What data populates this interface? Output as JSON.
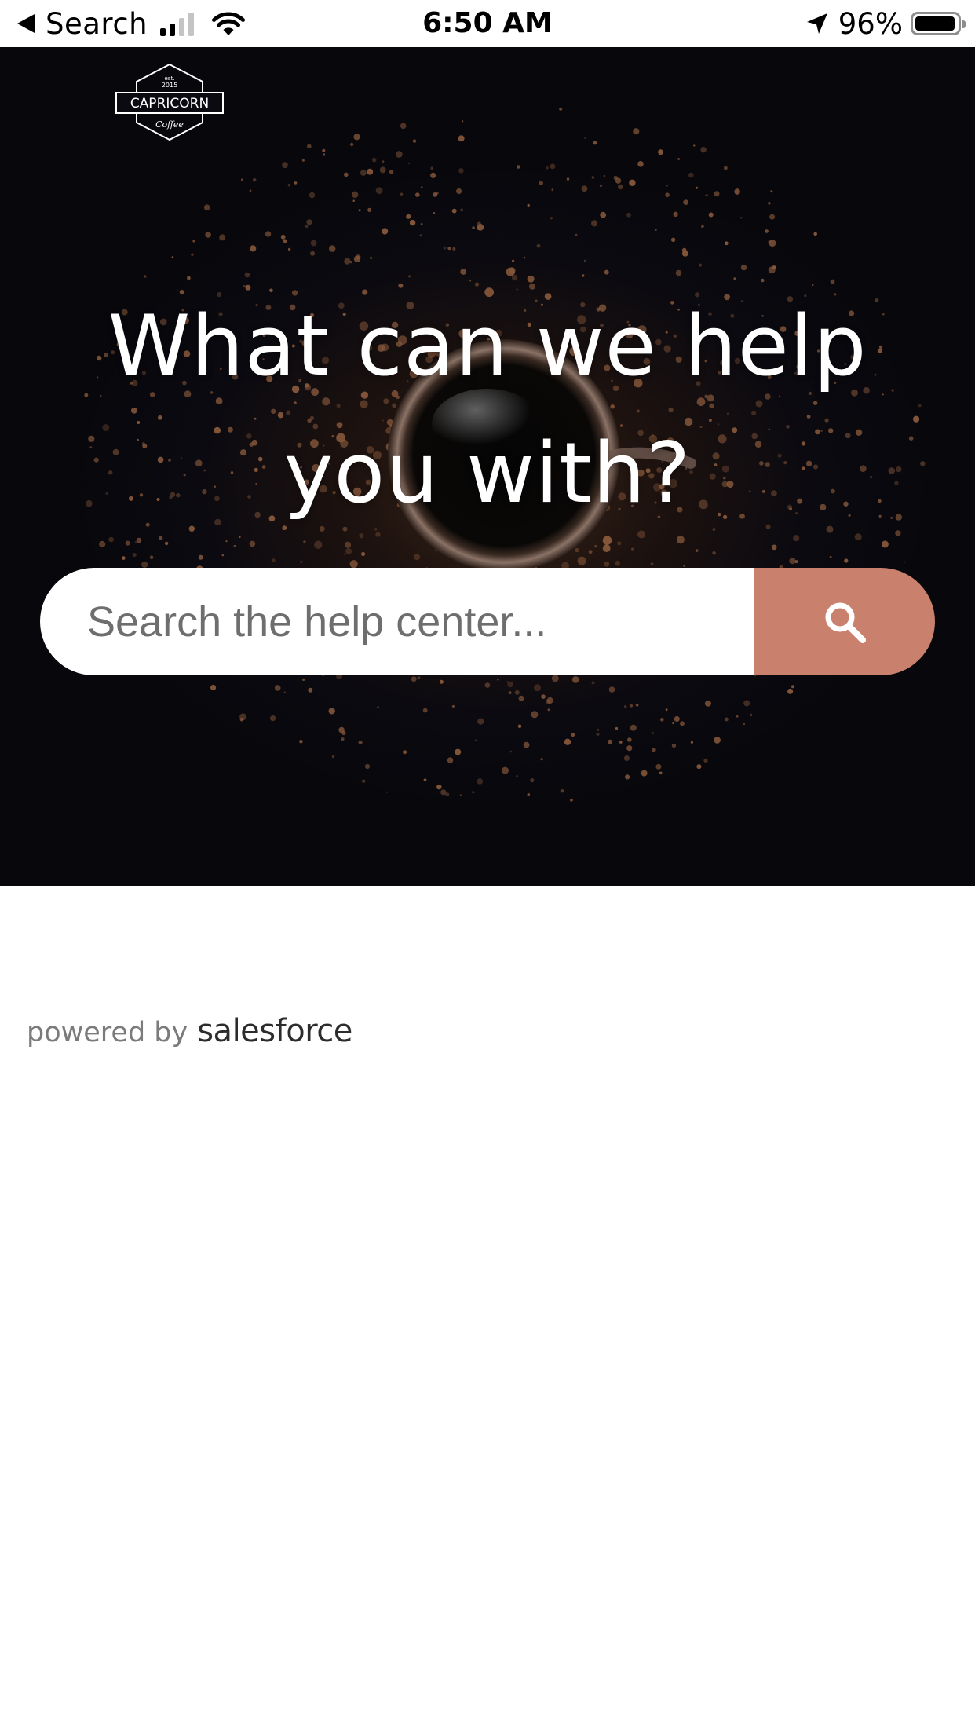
{
  "status_bar": {
    "back_label": "Search",
    "time": "6:50 AM",
    "battery_percent": "96%",
    "battery_level": 0.96,
    "signal_bars": 2,
    "signal_bars_total": 4
  },
  "header": {
    "logo": {
      "est": "est.",
      "year": "2015",
      "name": "CAPRICORN",
      "tagline": "Coffee"
    }
  },
  "hero": {
    "title": "What can we help you with?"
  },
  "search": {
    "placeholder": "Search the help center...",
    "value": "",
    "button_icon": "search-icon"
  },
  "footer": {
    "powered_by": "powered by",
    "brand": "salesforce"
  },
  "colors": {
    "accent": "#c9816d",
    "hero_background": "#07070c",
    "text_light": "#ffffff",
    "muted_text": "#7b7b7b"
  }
}
